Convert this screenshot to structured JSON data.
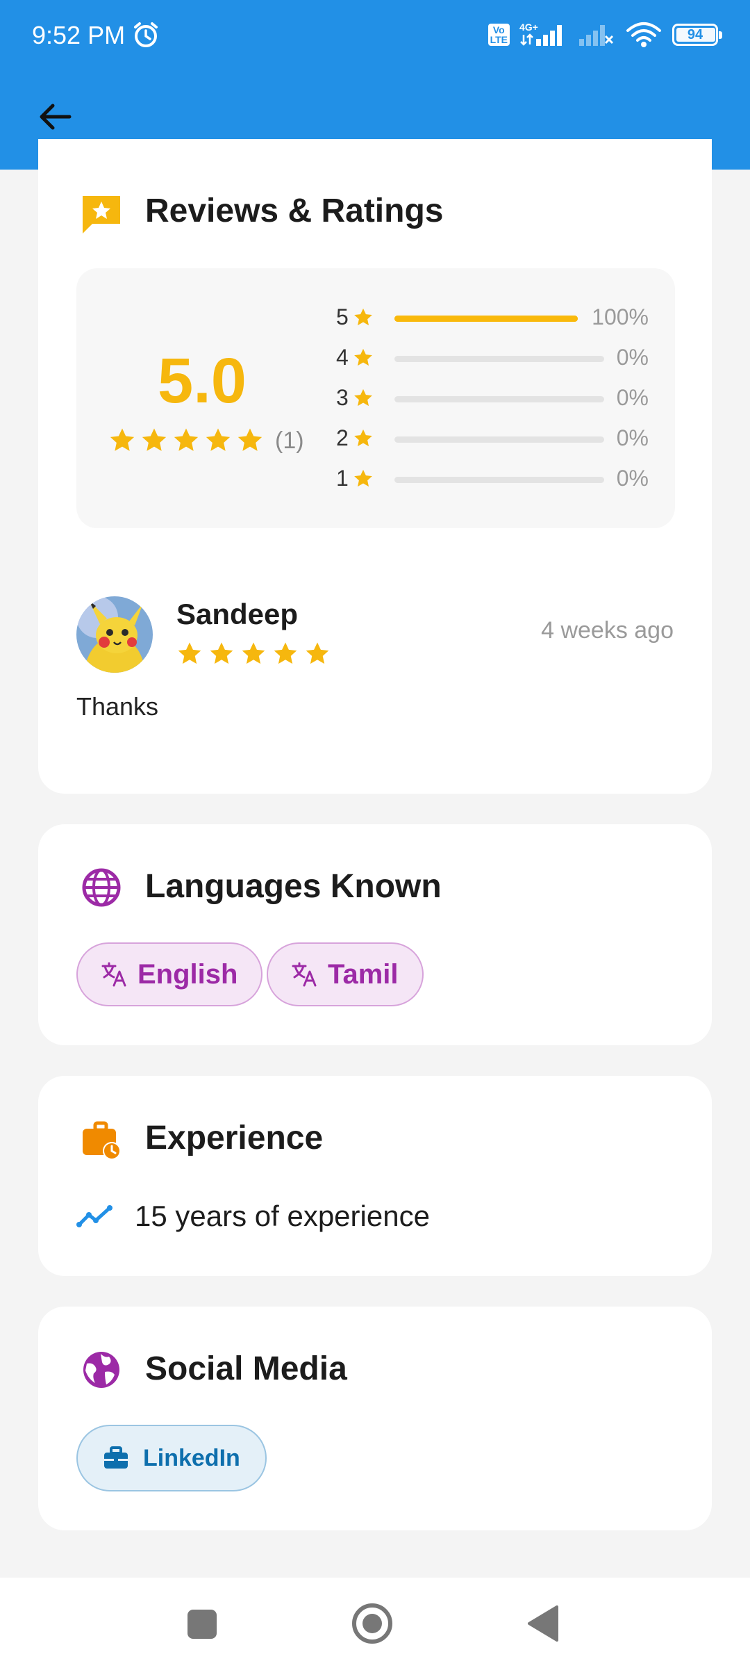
{
  "status_bar": {
    "time": "9:52 PM",
    "network": "4G+",
    "volte": "Vo\nLTE",
    "battery": "94"
  },
  "colors": {
    "appbar": "#2290e6",
    "star": "#f6b70e",
    "language_accent": "#9c2aa6",
    "experience_accent": "#f08a00",
    "trend_accent": "#2290e6",
    "linkedin_accent": "#0e6fad"
  },
  "icons": {
    "back": "arrow-left-icon",
    "reviews": "star-chat-icon",
    "languages": "globe-icon",
    "translate": "translate-icon",
    "experience": "briefcase-clock-icon",
    "trend": "trending-up-icon",
    "social": "public-globe-icon",
    "linkedin": "briefcase-icon"
  },
  "reviews": {
    "title": "Reviews & Ratings",
    "average": "5.0",
    "average_stars": 5,
    "count": "(1)",
    "breakdown": [
      {
        "stars": "5",
        "percent": "100%",
        "fraction": 1.0
      },
      {
        "stars": "4",
        "percent": "0%",
        "fraction": 0
      },
      {
        "stars": "3",
        "percent": "0%",
        "fraction": 0
      },
      {
        "stars": "2",
        "percent": "0%",
        "fraction": 0
      },
      {
        "stars": "1",
        "percent": "0%",
        "fraction": 0
      }
    ],
    "items": [
      {
        "name": "Sandeep",
        "rating": 5,
        "time": "4 weeks ago",
        "text": "Thanks"
      }
    ]
  },
  "languages": {
    "title": "Languages Known",
    "items": [
      "English",
      "Tamil"
    ]
  },
  "experience": {
    "title": "Experience",
    "text": "15 years of experience"
  },
  "social": {
    "title": "Social Media",
    "links": [
      "LinkedIn"
    ]
  },
  "nav": {
    "recent": "square-icon",
    "home": "circle-icon",
    "back": "triangle-back-icon"
  }
}
